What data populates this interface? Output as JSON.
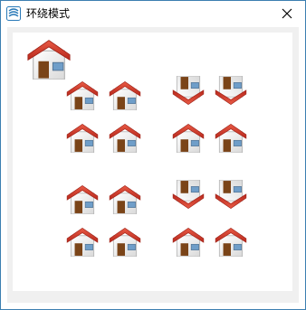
{
  "window": {
    "title": "环绕模式",
    "app_icon": "app-logo-icon",
    "close_icon": "close-icon"
  },
  "canvas": {
    "icon": "house-icon",
    "icon_count": 17,
    "groups": [
      {
        "name": "top-left",
        "orientation": "upright"
      },
      {
        "name": "top-right",
        "orientation": "mixed"
      },
      {
        "name": "bottom-left",
        "orientation": "upright"
      },
      {
        "name": "bottom-right",
        "orientation": "mixed"
      }
    ]
  },
  "colors": {
    "roof": "#d23c2c",
    "door": "#7a4418",
    "window_glass": "#6f9ec9",
    "frame": "#3c7fb1"
  }
}
